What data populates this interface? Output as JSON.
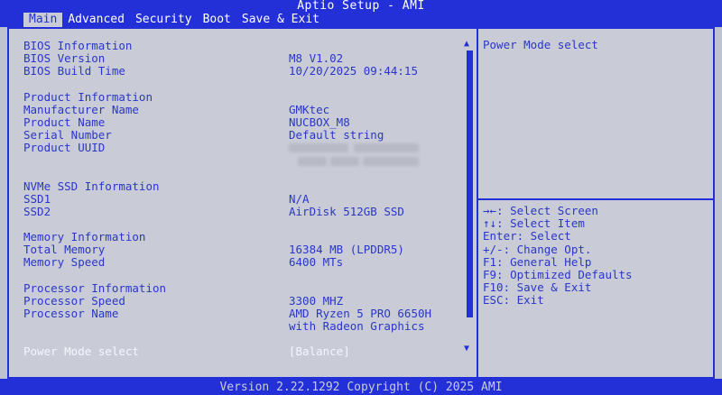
{
  "header": {
    "title": "Aptio Setup - AMI",
    "tabs": [
      {
        "label": "Main"
      },
      {
        "label": "Advanced"
      },
      {
        "label": "Security"
      },
      {
        "label": "Boot"
      },
      {
        "label": "Save & Exit"
      }
    ]
  },
  "info": {
    "bios_header": "BIOS Information",
    "bios_version_label": "BIOS Version",
    "bios_version_value": "M8 V1.02",
    "bios_build_label": "BIOS Build Time",
    "bios_build_value": "10/20/2025 09:44:15",
    "product_header": "Product Information",
    "manufacturer_label": "Manufacturer Name",
    "manufacturer_value": "GMKtec",
    "product_name_label": "Product Name",
    "product_name_value": "NUCBOX_M8",
    "serial_label": "Serial Number",
    "serial_value": "Default string",
    "uuid_label": "Product UUID",
    "nvme_header": "NVMe SSD Information",
    "ssd1_label": "SSD1",
    "ssd1_value": "N/A",
    "ssd2_label": "SSD2",
    "ssd2_value": "AirDisk 512GB SSD",
    "memory_header": "Memory Information",
    "total_memory_label": "Total Memory",
    "total_memory_value": "16384 MB (LPDDR5)",
    "memory_speed_label": "Memory Speed",
    "memory_speed_value": "6400 MTs",
    "processor_header": "Processor Information",
    "processor_speed_label": "Processor Speed",
    "processor_speed_value": "3300 MHZ",
    "processor_name_label": "Processor Name",
    "processor_name_value_1": "AMD Ryzen 5 PRO 6650H",
    "processor_name_value_2": "with Radeon Graphics",
    "power_mode_label": "Power Mode select",
    "power_mode_value": "[Balance]"
  },
  "help": {
    "description": "Power Mode select",
    "keys": [
      "→←: Select Screen",
      "↑↓: Select Item",
      "Enter: Select",
      "+/-: Change Opt.",
      "F1: General Help",
      "F9: Optimized Defaults",
      "F10: Save & Exit",
      "ESC: Exit"
    ]
  },
  "footer": {
    "text": "Version 2.22.1292 Copyright (C) 2025 AMI"
  },
  "colors": {
    "bios_blue": "#2330d8",
    "panel_bg": "#c9ccd6",
    "selected_text": "#f4f6ff"
  },
  "icons": {
    "scroll_up": "scroll-up-arrow-icon",
    "scroll_down": "scroll-down-arrow-icon"
  }
}
